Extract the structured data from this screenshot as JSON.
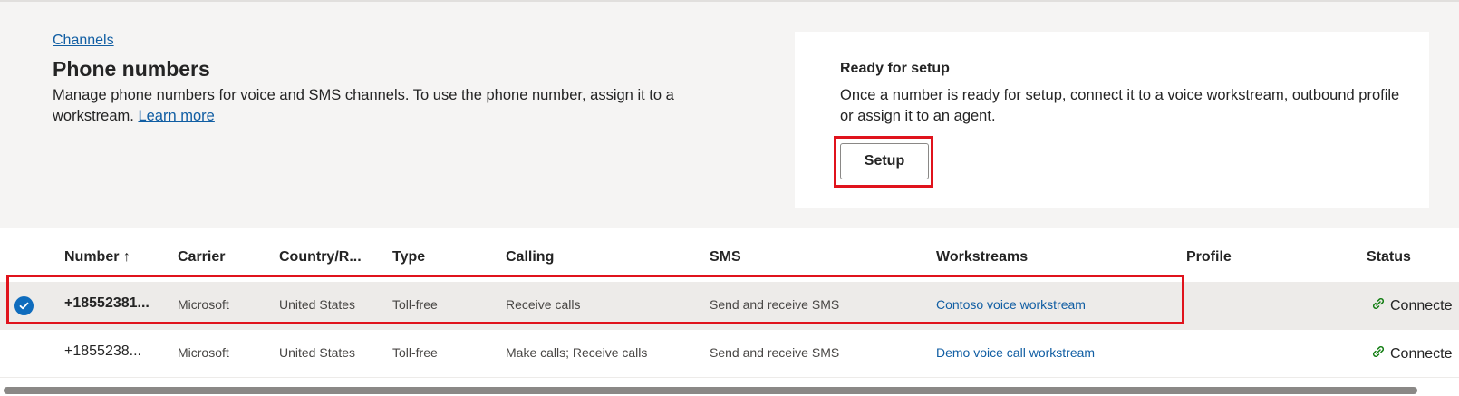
{
  "header": {
    "breadcrumb": "Channels",
    "title": "Phone numbers",
    "description": "Manage phone numbers for voice and SMS channels. To use the phone number, assign it to a workstream.",
    "learn_more": "Learn more"
  },
  "setup_card": {
    "title": "Ready for setup",
    "description": "Once a number is ready for setup, connect it to a voice workstream, outbound profile or assign it to an agent.",
    "button_label": "Setup"
  },
  "table": {
    "columns": {
      "number": "Number ↑",
      "carrier": "Carrier",
      "country": "Country/R...",
      "type": "Type",
      "calling": "Calling",
      "sms": "SMS",
      "workstreams": "Workstreams",
      "profile": "Profile",
      "status": "Status"
    },
    "rows": [
      {
        "number": "+18552381...",
        "carrier": "Microsoft",
        "country": "United States",
        "type": "Toll-free",
        "calling": "Receive calls",
        "sms": "Send and receive SMS",
        "workstream": "Contoso voice workstream",
        "profile": "",
        "status": "Connecte"
      },
      {
        "number": "+1855238...",
        "carrier": "Microsoft",
        "country": "United States",
        "type": "Toll-free",
        "calling": "Make calls; Receive calls",
        "sms": "Send and receive SMS",
        "workstream": "Demo voice call workstream",
        "profile": "",
        "status": "Connecte"
      }
    ]
  },
  "icons": {
    "row_selected": "checkmark-circle-icon",
    "status_connected": "link-icon"
  },
  "colors": {
    "accent": "#0f6cbd",
    "link": "#115ea3",
    "highlight": "#e0131c",
    "status_green": "#107c10"
  }
}
